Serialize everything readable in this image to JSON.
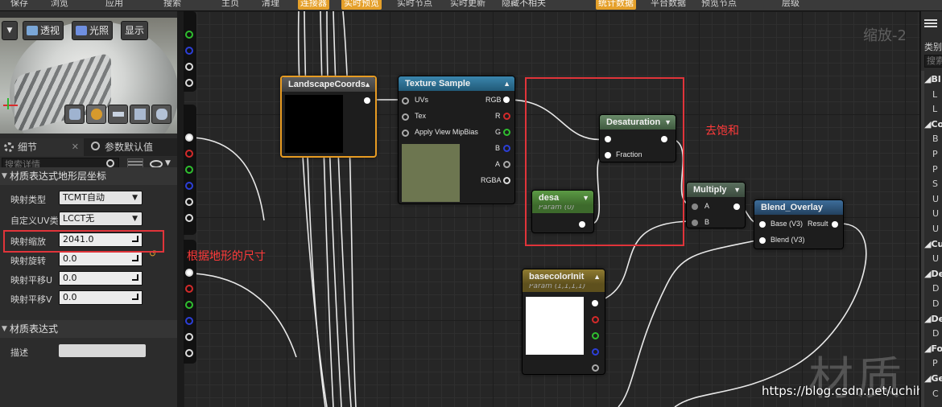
{
  "toolbar": {
    "items": [
      "保存",
      "浏览",
      "应用",
      "搜索",
      "主页",
      "清理",
      "连接器",
      "实时预览",
      "实时节点",
      "实时更新",
      "隐藏不相关",
      "统计数据",
      "平台数据",
      "预览节点",
      "层级"
    ],
    "active_color": "#e5a02a"
  },
  "viewport": {
    "buttons": {
      "perspective": "透视",
      "lighting": "光照",
      "show": "显示"
    }
  },
  "details": {
    "tab_details": "细节",
    "tab_defaults": "参数默认值",
    "search_placeholder": "搜索详情",
    "section_title": "材质表达式地形层坐标",
    "props": [
      {
        "label": "映射类型",
        "value": "TCMT自动"
      },
      {
        "label": "自定义UV类",
        "value": "LCCT无"
      },
      {
        "label": "映射缩放",
        "value": "2041.0"
      },
      {
        "label": "映射旋转",
        "value": "0.0"
      },
      {
        "label": "映射平移U",
        "value": "0.0"
      },
      {
        "label": "映射平移V",
        "value": "0.0"
      }
    ],
    "section2_title": "材质表达式",
    "description_label": "描述"
  },
  "graph": {
    "zoom": "缩放-2",
    "nodes": {
      "landscape": {
        "title": "LandscapeCoords"
      },
      "texture": {
        "title": "Texture Sample",
        "inputs": [
          "UVs",
          "Tex",
          "Apply View MipBias"
        ],
        "outputs": [
          "RGB",
          "R",
          "G",
          "B",
          "A",
          "RGBA"
        ]
      },
      "desaturation": {
        "title": "Desaturation",
        "input": "Fraction"
      },
      "desa": {
        "title": "desa",
        "sub": "Param (0)"
      },
      "multiply": {
        "title": "Multiply",
        "inputs": [
          "A",
          "B"
        ]
      },
      "blend": {
        "title": "Blend_Overlay",
        "inputs": [
          "Base (V3)",
          "Blend (V3)"
        ],
        "output": "Result"
      },
      "basecolor": {
        "title": "basecolorInit",
        "sub": "Param (1,1,1,1)"
      }
    },
    "annotations": {
      "desat": "去饱和",
      "scale": "根据地形的尺寸"
    },
    "watermark": "材质",
    "watermark_url": "https://blog.csdn.net/uchihalyn"
  },
  "palette": {
    "title": "类别",
    "search_placeholder": "搜索",
    "entries": [
      {
        "type": "cat",
        "text": "Bl"
      },
      {
        "type": "item",
        "text": "L"
      },
      {
        "type": "item",
        "text": "L"
      },
      {
        "type": "cat",
        "text": "Co"
      },
      {
        "type": "item",
        "text": "B"
      },
      {
        "type": "item",
        "text": "P"
      },
      {
        "type": "item",
        "text": "P"
      },
      {
        "type": "item",
        "text": "S"
      },
      {
        "type": "item",
        "text": "U"
      },
      {
        "type": "item",
        "text": "U"
      },
      {
        "type": "item",
        "text": "U"
      },
      {
        "type": "cat",
        "text": "Cu"
      },
      {
        "type": "item",
        "text": "U"
      },
      {
        "type": "cat",
        "text": "De"
      },
      {
        "type": "item",
        "text": "D"
      },
      {
        "type": "item",
        "text": "D"
      },
      {
        "type": "cat",
        "text": "De"
      },
      {
        "type": "item",
        "text": "D"
      },
      {
        "type": "cat",
        "text": "Fo"
      },
      {
        "type": "item",
        "text": "P"
      },
      {
        "type": "cat",
        "text": "Ge"
      },
      {
        "type": "item",
        "text": "C"
      }
    ]
  },
  "colors": {
    "annotation": "#e0343a",
    "texture_header": "#2f6d8c",
    "desaturation_header": "#4f6d4f",
    "param_header": "#4c7a3c",
    "basecolor_header": "#7d6a2a",
    "blend_header": "#2c4d6c",
    "multiply_header": "#47594a"
  }
}
